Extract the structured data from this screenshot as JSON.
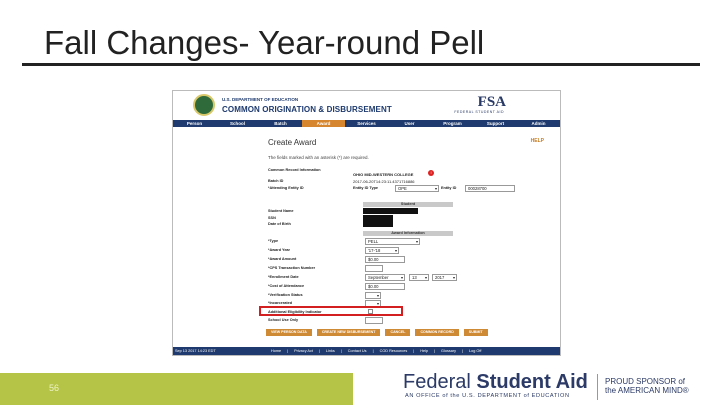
{
  "slide": {
    "title": "Fall Changes- Year-round Pell",
    "number": "56"
  },
  "app": {
    "dept": "U.S. DEPARTMENT OF EDUCATION",
    "name": "COMMON ORIGINATION & DISBURSEMENT",
    "fsa_logo": "FSA",
    "fsa_sub": "FEDERAL STUDENT AID"
  },
  "nav": [
    "Person",
    "School",
    "Batch",
    "Award",
    "Services",
    "User",
    "Program",
    "Support",
    "Admin"
  ],
  "nav_active": "Award",
  "page": {
    "title": "Create Award",
    "help": "HELP",
    "note": "The fields marked with an asterisk (*) are required."
  },
  "record": {
    "section_label": "Common Record Information",
    "school_name": "OHIO MID-WESTERN COLLEGE",
    "batch_label": "Batch ID",
    "batch_id": "2017-06-20T14:23:11.4371716886",
    "entity_label": "*Attending Entity ID",
    "entity_type_label": "Entity ID Type",
    "entity_type_value": "OPE",
    "entity_id_label": "Entity ID",
    "entity_id_value": "00028700"
  },
  "student": {
    "section": "Student",
    "name_label": "Student Name",
    "ssn_label": "SSN",
    "dob_label": "Date of Birth"
  },
  "award": {
    "section": "Award Information",
    "type_label": "*Type",
    "type_value": "PELL",
    "year_label": "*Award Year",
    "year_value": "'17-'18",
    "amount_label": "*Award Amount",
    "amount_value": "$0.00",
    "cps_label": "*CPS Transaction Number",
    "enroll_label": "*Enrollment Date",
    "enroll_month": "September",
    "enroll_day": "13",
    "enroll_year": "2017",
    "coa_label": "*Cost of Attendance",
    "coa_value": "$0.00",
    "verif_label": "*Verification Status",
    "incarc_label": "*Incarcerated",
    "aei_label": "Additional Eligibility Indicator",
    "school_use_label": "School Use Only"
  },
  "buttons": [
    "VIEW PERSON DATA",
    "CREATE NEW DISBURSEMENT",
    "CANCEL",
    "COMMON RECORD",
    "SUBMIT"
  ],
  "footer": {
    "date": "Sep 13 2017 14:23 EDT",
    "links": [
      "Home",
      "|",
      "Privacy Act",
      "|",
      "Links",
      "|",
      "Contact Us",
      "|",
      "COD Resources",
      "|",
      "Help",
      "|",
      "Glossary",
      "|",
      "Log Off"
    ]
  },
  "branding": {
    "fsa_light": "Federal ",
    "fsa_bold": "Student Aid",
    "fsa_tagline": "AN OFFICE of the U.S. DEPARTMENT of EDUCATION",
    "sponsor_line1": "PROUD SPONSOR of",
    "sponsor_line2": "the AMERICAN MIND®"
  },
  "colors": {
    "nav_bg": "#1f3a6e",
    "accent_orange": "#cf8a36",
    "highlight_red": "#d31f1f",
    "green_bar": "#b5c447"
  }
}
